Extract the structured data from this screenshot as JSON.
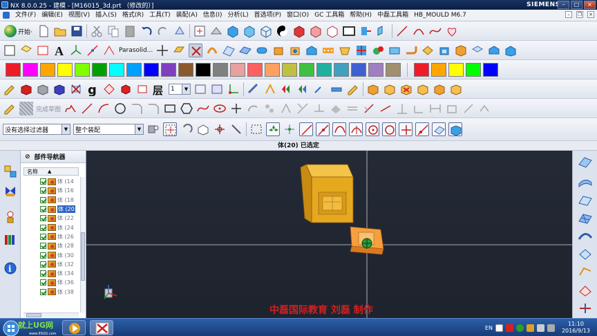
{
  "window": {
    "title": "NX 8.0.0.25 - 建模 - [M16015_3d.prt （修改的）]",
    "brand": "SIEMENS"
  },
  "menu": {
    "items": [
      "文件(F)",
      "编辑(E)",
      "视图(V)",
      "插入(S)",
      "格式(R)",
      "工具(T)",
      "装配(A)",
      "信息(I)",
      "分析(L)",
      "首选项(P)",
      "窗口(O)",
      "GC 工具箱",
      "帮助(H)",
      "中磊工具箱",
      "HB_MOULD M6.7"
    ]
  },
  "toolbar": {
    "start_label": "开始·",
    "parasolid_label": "Parasolid...",
    "layer_value": "1",
    "sketch_label": "完成草图"
  },
  "palette": {
    "colors_a": [
      "#ee1c24",
      "#ff00ff",
      "#ffa500",
      "#ffff00",
      "#7fff00",
      "#00a000",
      "#00ffff",
      "#00a0ff",
      "#0000ff",
      "#7f3fbf",
      "#8b5a2b",
      "#000000",
      "#808080",
      "#e8a0a0",
      "#ff6060",
      "#ffa060",
      "#c0c040",
      "#40c040",
      "#20b0a0",
      "#40a0c0",
      "#4060d0",
      "#a080c0",
      "#a09070"
    ],
    "colors_b": [
      "#ee1c24",
      "#ffa500",
      "#ffff00",
      "#00ff00",
      "#0000ff"
    ]
  },
  "selection": {
    "filter_value": "没有选择过滤器",
    "scope_value": "整个装配"
  },
  "status": {
    "text": "体(20) 已选定"
  },
  "navigator": {
    "title": "部件导航器",
    "column_name": "名称",
    "items": [
      "体 (14",
      "体 (16",
      "体 (18",
      "体 (20",
      "体 (22",
      "体 (24",
      "体 (26",
      "体 (28",
      "体 (30",
      "体 (32",
      "体 (34",
      "体 (36",
      "体 (38"
    ],
    "selected_index": 3
  },
  "viewport": {
    "watermark": "中磊国际教育    刘磊    制作",
    "colors": {
      "background": "#20252f",
      "part": "#e6a81e",
      "crosshair": "#e8e8e8",
      "watermark": "#d22020"
    }
  },
  "taskbar": {
    "logo_text": "就上UG网",
    "logo_sub": "www.9SUG.com",
    "ime": "EN",
    "time": "11:10",
    "date": "2016/9/13"
  },
  "colors": {
    "title_bg": "#0f2a57",
    "accent": "#2f64c6"
  }
}
